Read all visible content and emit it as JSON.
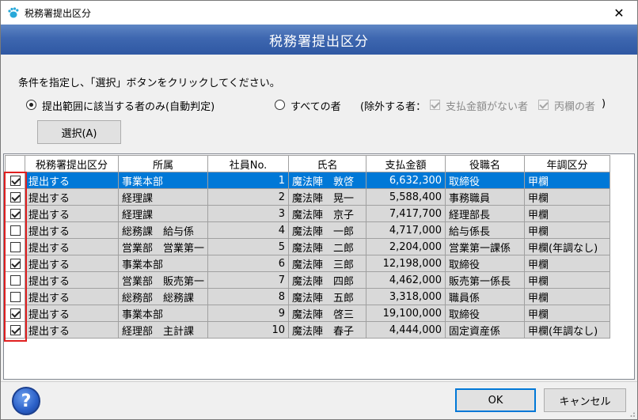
{
  "window": {
    "title": "税務署提出区分",
    "close_glyph": "✕",
    "icon": "app-hand-icon"
  },
  "header": {
    "title": "税務署提出区分"
  },
  "instruction": "条件を指定し、「選択」ボタンをクリックしてください。",
  "options": {
    "radio_auto_label": "提出範囲に該当する者のみ(自動判定)",
    "radio_auto_checked": true,
    "radio_all_label": "すべての者",
    "radio_all_checked": false,
    "exclude_label": "(除外する者：",
    "exclude_nopay_label": "支払金額がない者",
    "exclude_otsu_label": "丙欄の者",
    "exclude_close": ")"
  },
  "select_button": "選択(A)",
  "table": {
    "columns": [
      "",
      "税務署提出区分",
      "所属",
      "社員No.",
      "氏名",
      "支払金額",
      "役職名",
      "年調区分"
    ],
    "rows": [
      {
        "checked": true,
        "kubun": "提出する",
        "dept": "事業本部",
        "no": "1",
        "name": "魔法陣　敦啓",
        "amount": "6,632,300",
        "title": "取締役",
        "nencho": "甲欄",
        "selected": true
      },
      {
        "checked": true,
        "kubun": "提出する",
        "dept": "経理課",
        "no": "2",
        "name": "魔法陣　晃一",
        "amount": "5,588,400",
        "title": "事務職員",
        "nencho": "甲欄",
        "selected": false
      },
      {
        "checked": true,
        "kubun": "提出する",
        "dept": "経理課",
        "no": "3",
        "name": "魔法陣　京子",
        "amount": "7,417,700",
        "title": "経理部長",
        "nencho": "甲欄",
        "selected": false
      },
      {
        "checked": false,
        "kubun": "提出する",
        "dept": "総務課　給与係",
        "no": "4",
        "name": "魔法陣　一郎",
        "amount": "4,717,000",
        "title": "給与係長",
        "nencho": "甲欄",
        "selected": false
      },
      {
        "checked": false,
        "kubun": "提出する",
        "dept": "営業部　営業第一",
        "no": "5",
        "name": "魔法陣　二郎",
        "amount": "2,204,000",
        "title": "営業第一課係",
        "nencho": "甲欄(年調なし)",
        "selected": false
      },
      {
        "checked": true,
        "kubun": "提出する",
        "dept": "事業本部",
        "no": "6",
        "name": "魔法陣　三郎",
        "amount": "12,198,000",
        "title": "取締役",
        "nencho": "甲欄",
        "selected": false
      },
      {
        "checked": false,
        "kubun": "提出する",
        "dept": "営業部　販売第一",
        "no": "7",
        "name": "魔法陣　四郎",
        "amount": "4,462,000",
        "title": "販売第一係長",
        "nencho": "甲欄",
        "selected": false
      },
      {
        "checked": false,
        "kubun": "提出する",
        "dept": "総務部　総務課",
        "no": "8",
        "name": "魔法陣　五郎",
        "amount": "3,318,000",
        "title": "職員係",
        "nencho": "甲欄",
        "selected": false
      },
      {
        "checked": true,
        "kubun": "提出する",
        "dept": "事業本部",
        "no": "9",
        "name": "魔法陣　啓三",
        "amount": "19,100,000",
        "title": "取締役",
        "nencho": "甲欄",
        "selected": false
      },
      {
        "checked": true,
        "kubun": "提出する",
        "dept": "経理部　主計課",
        "no": "10",
        "name": "魔法陣　春子",
        "amount": "4,444,000",
        "title": "固定資産係",
        "nencho": "甲欄(年調なし)",
        "selected": false
      }
    ]
  },
  "footer": {
    "help_glyph": "?",
    "ok_label": "OK",
    "cancel_label": "キャンセル"
  },
  "colors": {
    "header_band": "#3e67b0",
    "selected_row": "#0078d7",
    "highlight_frame": "#e02020"
  }
}
